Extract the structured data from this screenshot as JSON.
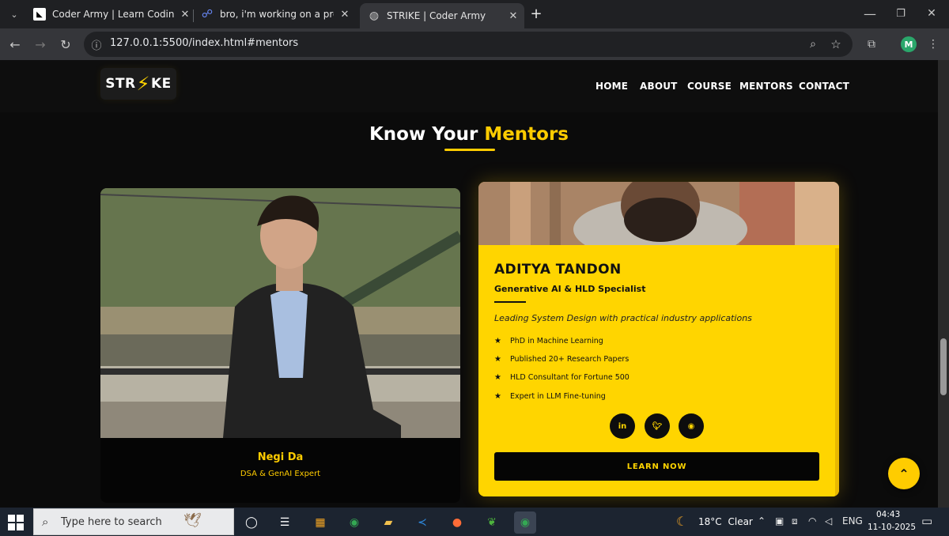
{
  "browser": {
    "tabs": [
      {
        "title": "Coder Army | Learn Coding in In",
        "favicon": "coder-army-icon"
      },
      {
        "title": "bro, i'm working on a project fo",
        "favicon": "ai-chat-icon"
      },
      {
        "title": "STRIKE | Coder Army",
        "favicon": "globe-icon",
        "active": true
      }
    ],
    "url": "127.0.0.1:5500/index.html#mentors",
    "profile_initial": "M"
  },
  "site": {
    "logo_left": "STR",
    "logo_bolt": "⚡",
    "logo_right": "KE",
    "nav": [
      "HOME",
      "ABOUT",
      "COURSE",
      "MENTORS",
      "CONTACT"
    ],
    "section_title_plain": "Know Your",
    "section_title_highlight": "Mentors",
    "accent_color": "#ffcc00",
    "mentors": [
      {
        "name": "Negi Da",
        "role": "DSA & GenAI Expert"
      },
      {
        "name": "ADITYA TANDON",
        "role": "Generative AI & HLD Specialist",
        "tagline": "Leading System Design with practical industry applications",
        "features": [
          "PhD in Machine Learning",
          "Published 20+ Research Papers",
          "HLD Consultant for Fortune 500",
          "Expert in LLM Fine-tuning"
        ],
        "socials": [
          "linkedin-icon",
          "twitter-icon",
          "github-icon"
        ],
        "cta": "LEARN NOW"
      }
    ]
  },
  "taskbar": {
    "search_placeholder": "Type here to search",
    "weather_temp": "18°C",
    "weather_text": "Clear",
    "language": "ENG",
    "time": "04:43",
    "date": "11-10-2025"
  }
}
